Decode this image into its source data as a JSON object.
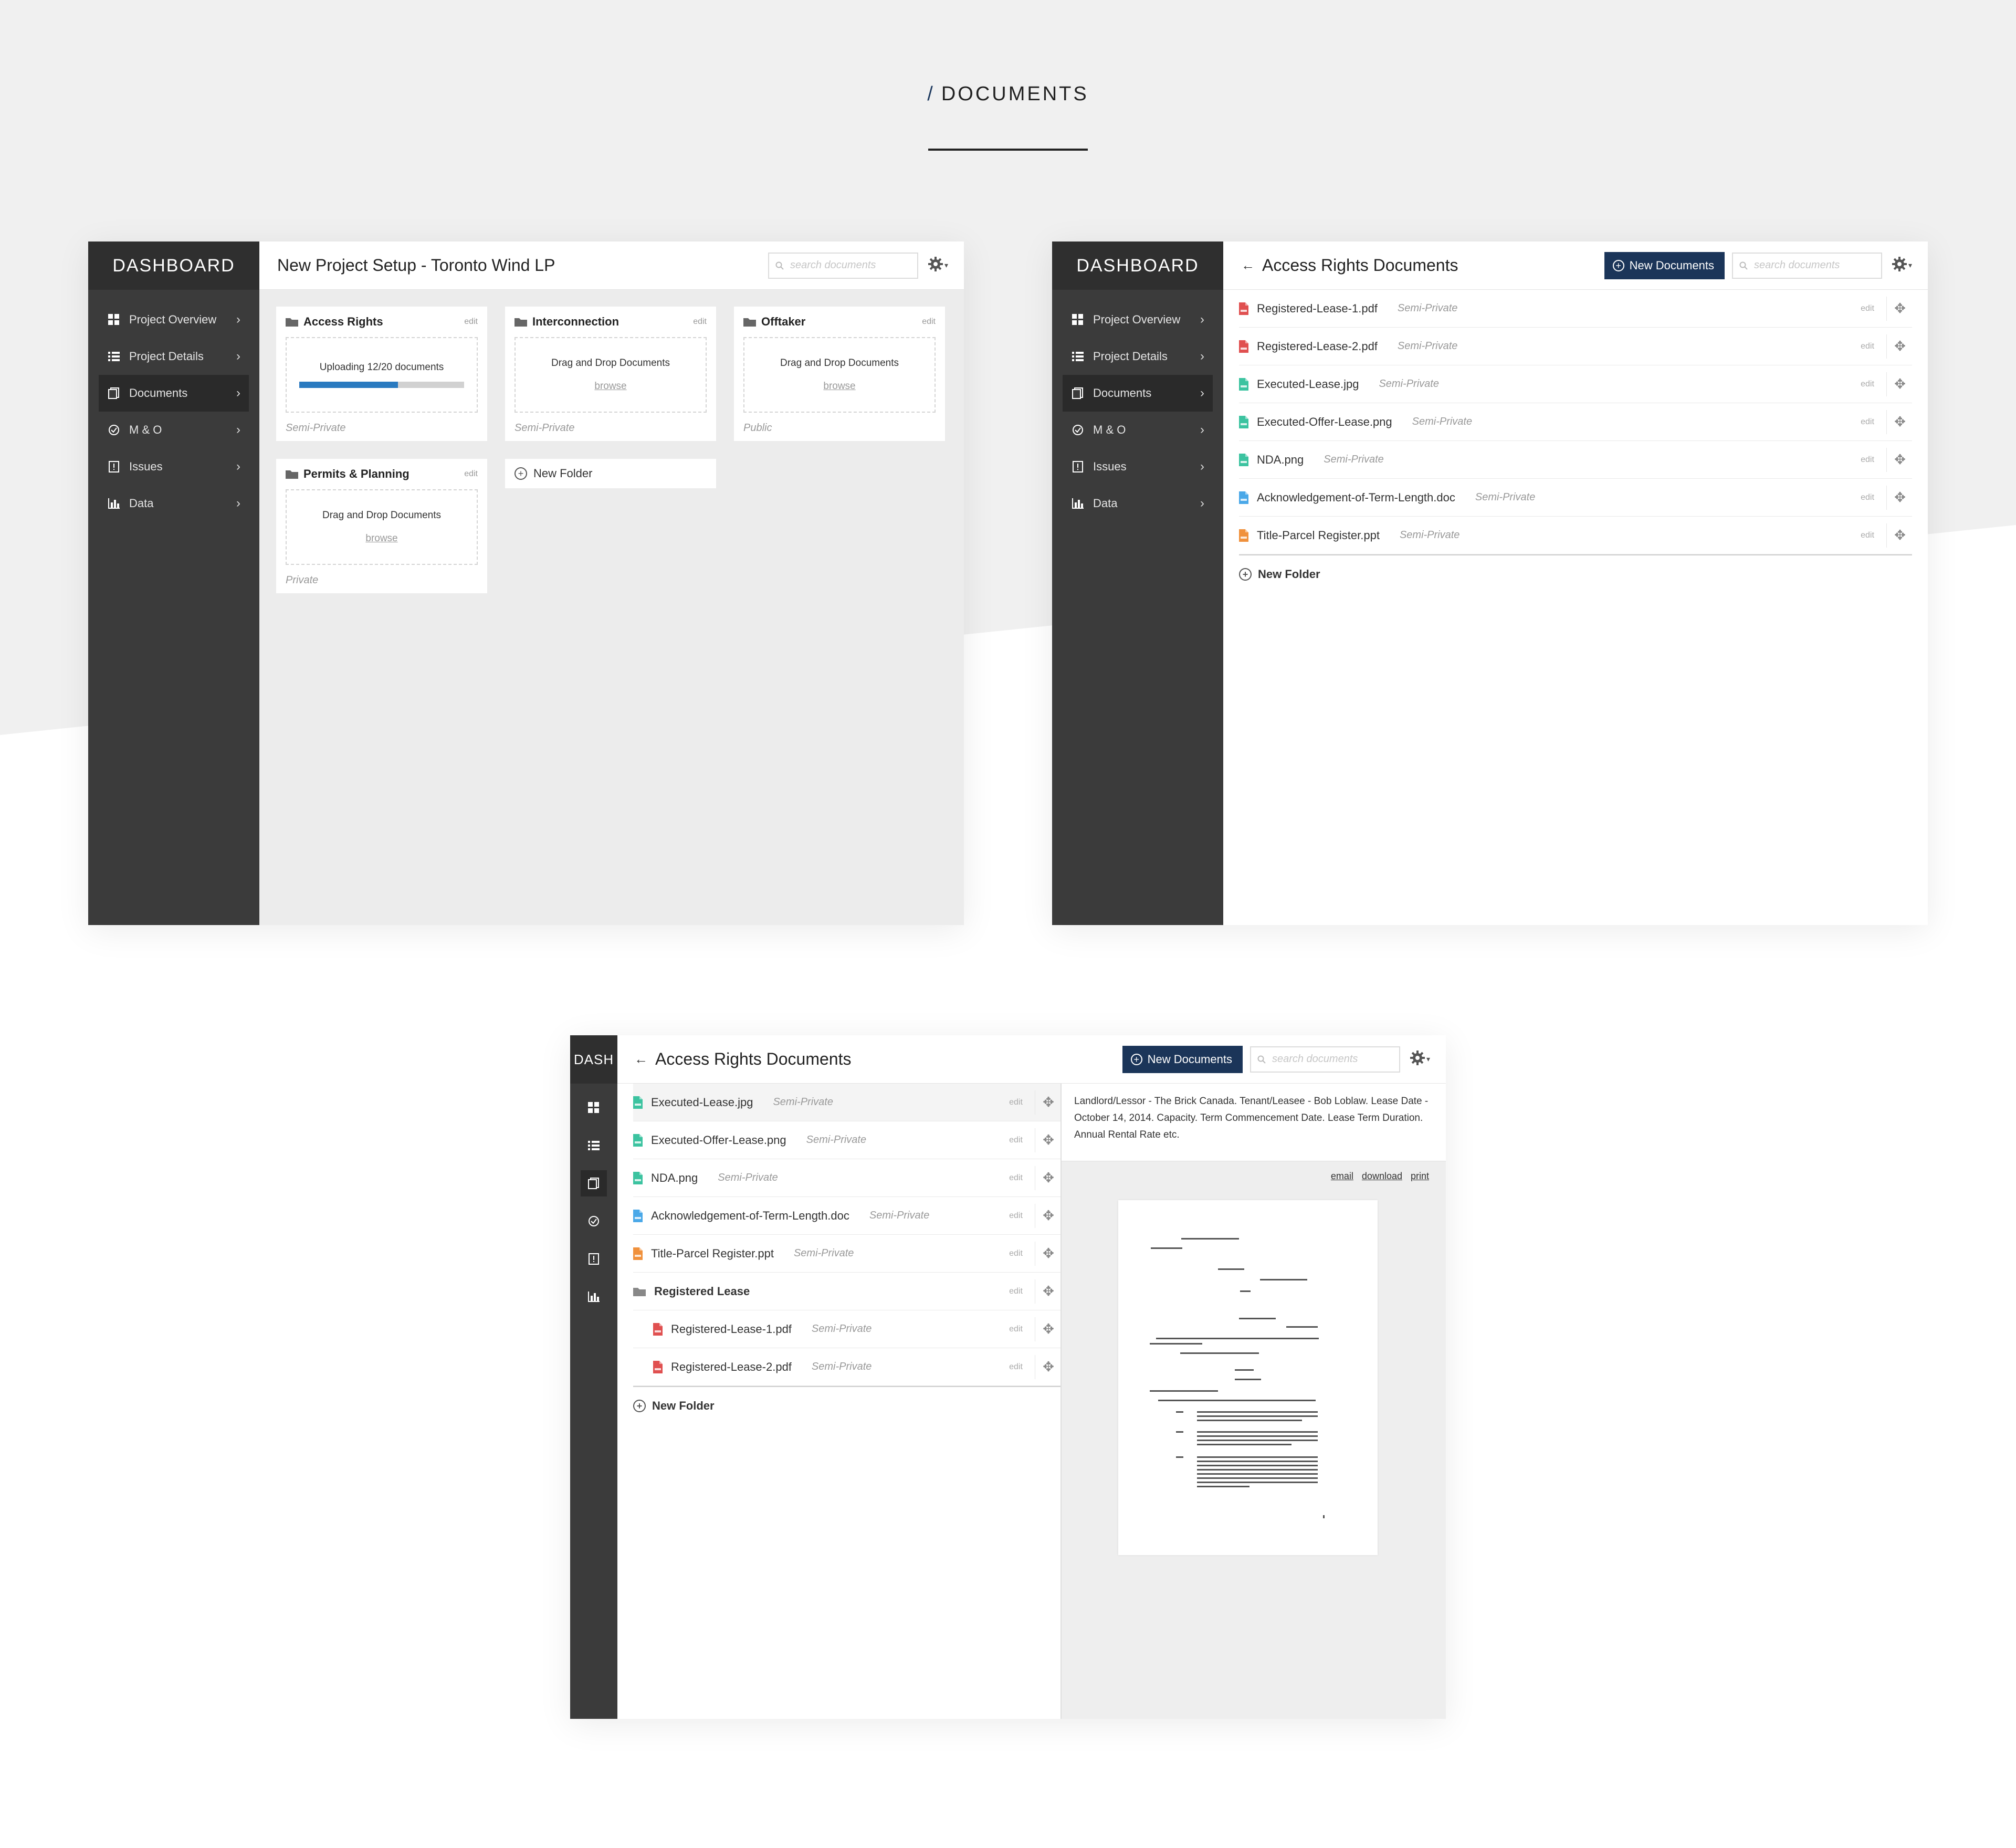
{
  "page": {
    "title_prefix": "/",
    "title": "DOCUMENTS"
  },
  "colors": {
    "accent": "#1b3559",
    "progress": "#2a7ac0",
    "sidebar": "#3b3b3b",
    "pdf": "#e05050",
    "image": "#3cc3a0",
    "doc": "#4aa8e8",
    "ppt": "#f0913c"
  },
  "sidebar": {
    "brand": "DASHBOARD",
    "brand_short": "DASH",
    "items": [
      {
        "label": "Project Overview",
        "icon": "grid-icon"
      },
      {
        "label": "Project Details",
        "icon": "list-icon"
      },
      {
        "label": "Documents",
        "icon": "documents-icon"
      },
      {
        "label": "M & O",
        "icon": "check-circle-icon"
      },
      {
        "label": "Issues",
        "icon": "alert-icon"
      },
      {
        "label": "Data",
        "icon": "bar-chart-icon"
      }
    ]
  },
  "screen1": {
    "title": "New Project Setup - Toronto Wind LP",
    "search_placeholder": "search documents",
    "folders": [
      {
        "name": "Access Rights",
        "edit": "edit",
        "status": "Uploading 12/20 documents",
        "progress": 0.6,
        "privacy": "Semi-Private"
      },
      {
        "name": "Interconnection",
        "edit": "edit",
        "drop": "Drag and Drop Documents",
        "browse": "browse",
        "privacy": "Semi-Private"
      },
      {
        "name": "Offtaker",
        "edit": "edit",
        "drop": "Drag and Drop Documents",
        "browse": "browse",
        "privacy": "Public"
      },
      {
        "name": "Permits & Planning",
        "edit": "edit",
        "drop": "Drag and Drop Documents",
        "browse": "browse",
        "privacy": "Private"
      }
    ],
    "new_folder": "New Folder"
  },
  "screen2": {
    "back": "←",
    "title": "Access Rights Documents",
    "new_docs": "New Documents",
    "search_placeholder": "search documents",
    "files": [
      {
        "name": "Registered-Lease-1.pdf",
        "privacy": "Semi-Private",
        "type": "pdf",
        "edit": "edit"
      },
      {
        "name": "Registered-Lease-2.pdf",
        "privacy": "Semi-Private",
        "type": "pdf",
        "edit": "edit"
      },
      {
        "name": "Executed-Lease.jpg",
        "privacy": "Semi-Private",
        "type": "image",
        "edit": "edit"
      },
      {
        "name": "Executed-Offer-Lease.png",
        "privacy": "Semi-Private",
        "type": "image",
        "edit": "edit"
      },
      {
        "name": "NDA.png",
        "privacy": "Semi-Private",
        "type": "image",
        "edit": "edit"
      },
      {
        "name": "Acknowledgement-of-Term-Length.doc",
        "privacy": "Semi-Private",
        "type": "doc",
        "edit": "edit"
      },
      {
        "name": "Title-Parcel Register.ppt",
        "privacy": "Semi-Private",
        "type": "ppt",
        "edit": "edit"
      }
    ],
    "new_folder": "New Folder"
  },
  "screen3": {
    "back": "←",
    "title": "Access Rights Documents",
    "new_docs": "New Documents",
    "search_placeholder": "search documents",
    "files": [
      {
        "name": "Executed-Lease.jpg",
        "privacy": "Semi-Private",
        "type": "image",
        "edit": "edit"
      },
      {
        "name": "Executed-Offer-Lease.png",
        "privacy": "Semi-Private",
        "type": "image",
        "edit": "edit"
      },
      {
        "name": "NDA.png",
        "privacy": "Semi-Private",
        "type": "image",
        "edit": "edit"
      },
      {
        "name": "Acknowledgement-of-Term-Length.doc",
        "privacy": "Semi-Private",
        "type": "doc",
        "edit": "edit"
      },
      {
        "name": "Title-Parcel Register.ppt",
        "privacy": "Semi-Private",
        "type": "ppt",
        "edit": "edit"
      }
    ],
    "folder": {
      "name": "Registered Lease",
      "edit": "edit"
    },
    "subfiles": [
      {
        "name": "Registered-Lease-1.pdf",
        "privacy": "Semi-Private",
        "type": "pdf",
        "edit": "edit"
      },
      {
        "name": "Registered-Lease-2.pdf",
        "privacy": "Semi-Private",
        "type": "pdf",
        "edit": "edit"
      }
    ],
    "new_folder": "New Folder",
    "detail": {
      "meta": "Landlord/Lessor - The Brick Canada. Tenant/Leasee - Bob Loblaw. Lease Date - October 14, 2014. Capacity. Term Commencement Date. Lease Term Duration. Annual Rental Rate etc.",
      "actions": [
        "email",
        "download",
        "print"
      ]
    }
  }
}
